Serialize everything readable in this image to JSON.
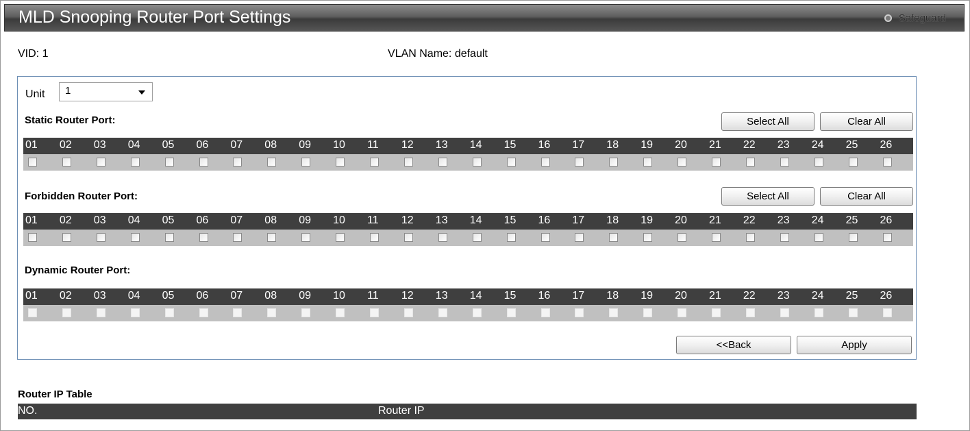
{
  "header": {
    "title": "MLD Snooping Router Port Settings",
    "safeguard_label": "Safeguard",
    "safeguard_icon": "circle-icon"
  },
  "info": {
    "vid_text": "VID: 1",
    "vlan_name_text": "VLAN Name:  default"
  },
  "unit": {
    "label": "Unit",
    "selected": "1"
  },
  "sections": [
    {
      "label": "Static Router Port:",
      "select_all": "Select All",
      "clear_all": "Clear All"
    },
    {
      "label": "Forbidden Router Port:",
      "select_all": "Select All",
      "clear_all": "Clear All"
    },
    {
      "label": "Dynamic Router Port:"
    }
  ],
  "ports": [
    "01",
    "02",
    "03",
    "04",
    "05",
    "06",
    "07",
    "08",
    "09",
    "10",
    "11",
    "12",
    "13",
    "14",
    "15",
    "16",
    "17",
    "18",
    "19",
    "20",
    "21",
    "22",
    "23",
    "24",
    "25",
    "26"
  ],
  "actions": {
    "back_label": "<<Back",
    "apply_label": "Apply"
  },
  "router_ip_table": {
    "title": "Router IP Table",
    "columns": [
      "NO.",
      "Router IP"
    ],
    "rows": []
  }
}
